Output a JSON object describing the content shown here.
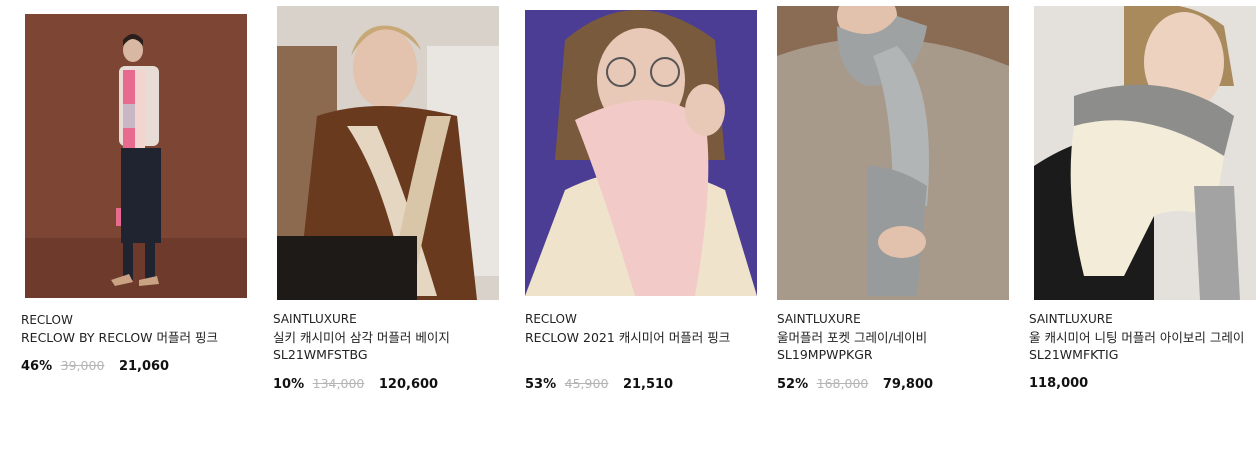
{
  "products": [
    {
      "brand": "RECLOW",
      "name": "RECLOW BY RECLOW 머플러 핑크",
      "discount": "46%",
      "original_price": "39,000",
      "price": "21,060",
      "image": {
        "kind": "model-full-body-pink-plaid-scarf",
        "bg": "#7b4333"
      }
    },
    {
      "brand": "SAINTLUXURE",
      "name": "실키 캐시미어 삼각 머플러 베이지 SL21WMFSTBG",
      "discount": "10%",
      "original_price": "134,000",
      "price": "120,600",
      "image": {
        "kind": "model-brown-satin-blouse-beige-scarf",
        "bg": "#d9d4cc"
      }
    },
    {
      "brand": "RECLOW",
      "name": "RECLOW 2021 캐시미어 머플러 핑크",
      "discount": "53%",
      "original_price": "45,900",
      "price": "21,510",
      "image": {
        "kind": "model-glasses-pink-scarf-purple-bg",
        "bg": "#4a3c93"
      }
    },
    {
      "brand": "SAINTLUXURE",
      "name": "울머플러 포켓 그레이/네이비 SL19MPWPKGR",
      "discount": "52%",
      "original_price": "168,000",
      "price": "79,800",
      "image": {
        "kind": "model-beige-knit-grey-scarf",
        "bg": "#8a6d55"
      }
    },
    {
      "brand": "SAINTLUXURE",
      "name": "울 캐시미어 니팅 머플러 아이보리 그레이 SL21WMFKTIG",
      "discount": "",
      "original_price": "",
      "price": "118,000",
      "image": {
        "kind": "model-leather-jacket-ivory-knit-scarf",
        "bg": "#e6e3df"
      }
    }
  ]
}
